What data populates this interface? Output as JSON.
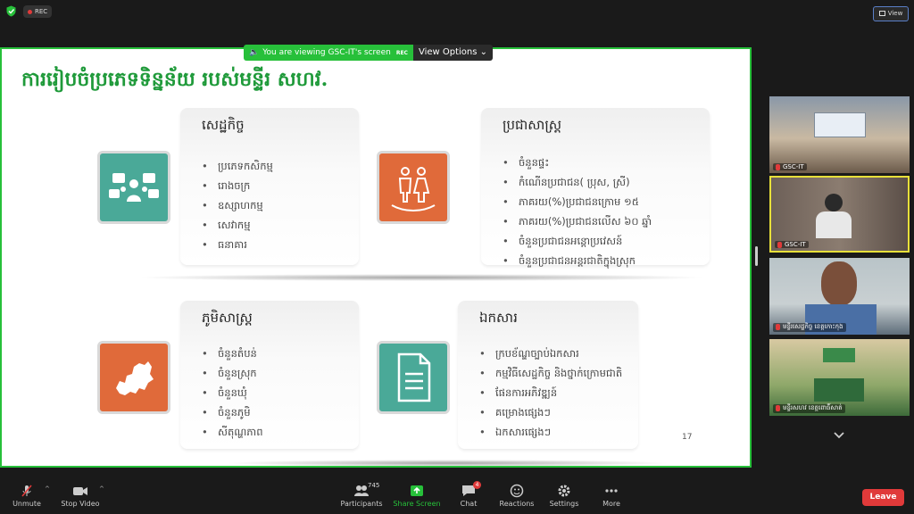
{
  "top": {
    "rec_label": "REC",
    "view_label": "View"
  },
  "share_banner": {
    "viewing_text": "You are viewing GSC-IT's screen",
    "rec_text": "REC",
    "view_options_label": "View Options"
  },
  "slide": {
    "title": "ការរៀបចំប្រភេទទិន្នន័យ របស់មន្ទីរ សហវ.",
    "page_number": "17",
    "sections": [
      {
        "title": "សេដ្ឋកិច្ច",
        "items": [
          "ប្រភេទកសិកម្ម",
          "រោងចក្រ",
          "ឧស្សាហកម្ម",
          "សេវាកម្ម",
          "ធនាគារ"
        ]
      },
      {
        "title": "ប្រជាសាស្ត្រ",
        "items": [
          "ចំនួនផ្ទះ",
          "កំណើនប្រជាជន( ប្រុស, ស្រី)",
          "ភាគរយ(%)ប្រជាជនក្រោម ១៥",
          "ភាគរយ(%)ប្រជាជនលើស ៦០ ឆ្នាំ",
          "ចំនួនប្រជាជនអន្តោប្រវេសន៍",
          "ចំនួនប្រជាជនអន្តរជាតិក្នុងស្រុក"
        ]
      },
      {
        "title": "ភូមិសាស្ត្រ",
        "items": [
          "ចំនួនតំបន់",
          "ចំនួនស្រុក",
          "ចំនួនឃុំ",
          "ចំនួនភូមិ",
          "សីតុណ្ហភាព"
        ]
      },
      {
        "title": "ឯកសារ",
        "items": [
          "ក្របខ័ណ្ឌច្បាប់ឯកសារ",
          "កម្មវិធីសេដ្ឋកិច្ច និងថ្នាក់ក្រោមជាតិ",
          "ផែនការអភិវឌ្ឍន៍",
          "គម្រោងផ្សេងៗ",
          "ឯកសារផ្សេងៗ"
        ]
      }
    ]
  },
  "participants_panel": {
    "tiles": [
      {
        "name": "GSC-IT"
      },
      {
        "name": "GSC-IT"
      },
      {
        "name": "មន្ទីរសេដ្ឋកិច្ច ខេត្តកោះកុង"
      },
      {
        "name": "មន្ទីរសហវ ខេត្តពោធិ៍សាត់"
      }
    ]
  },
  "toolbar": {
    "unmute": "Unmute",
    "stop_video": "Stop Video",
    "participants": "Participants",
    "participants_count": "745",
    "share_screen": "Share Screen",
    "chat": "Chat",
    "chat_badge": "4",
    "reactions": "Reactions",
    "settings": "Settings",
    "more": "More",
    "leave": "Leave"
  },
  "colors": {
    "share_green": "#27c03a",
    "title_green": "#1f9a3a",
    "teal": "#4aa998",
    "orange": "#e06a3a",
    "leave_red": "#e03a3a"
  }
}
